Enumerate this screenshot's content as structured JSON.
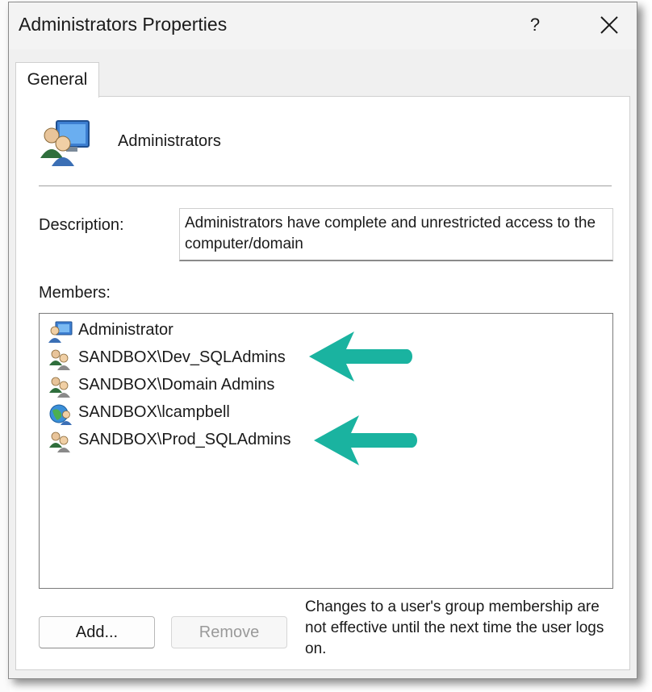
{
  "window": {
    "title": "Administrators Properties",
    "help_label": "?",
    "close_icon": "close-icon"
  },
  "tabs": [
    {
      "label": "General",
      "selected": true
    }
  ],
  "group": {
    "name": "Administrators",
    "icon": "user-group-computer-icon"
  },
  "description": {
    "label": "Description:",
    "value": "Administrators have complete and unrestricted access to the computer/domain"
  },
  "members": {
    "label": "Members:",
    "items": [
      {
        "name": "Administrator",
        "icon": "user-computer-icon"
      },
      {
        "name": "SANDBOX\\Dev_SQLAdmins",
        "icon": "user-group-icon",
        "highlighted": true
      },
      {
        "name": "SANDBOX\\Domain Admins",
        "icon": "user-group-icon"
      },
      {
        "name": "SANDBOX\\lcampbell",
        "icon": "globe-user-icon"
      },
      {
        "name": "SANDBOX\\Prod_SQLAdmins",
        "icon": "user-group-icon",
        "highlighted": true
      }
    ]
  },
  "buttons": {
    "add_label": "Add...",
    "remove_label": "Remove",
    "remove_disabled": true
  },
  "note": "Changes to a user's group membership are not effective until the next time the user logs on.",
  "colors": {
    "annotation_arrow": "#1ab3a0",
    "dialog_bg": "#f0f0f0",
    "panel_bg": "#ffffff"
  }
}
